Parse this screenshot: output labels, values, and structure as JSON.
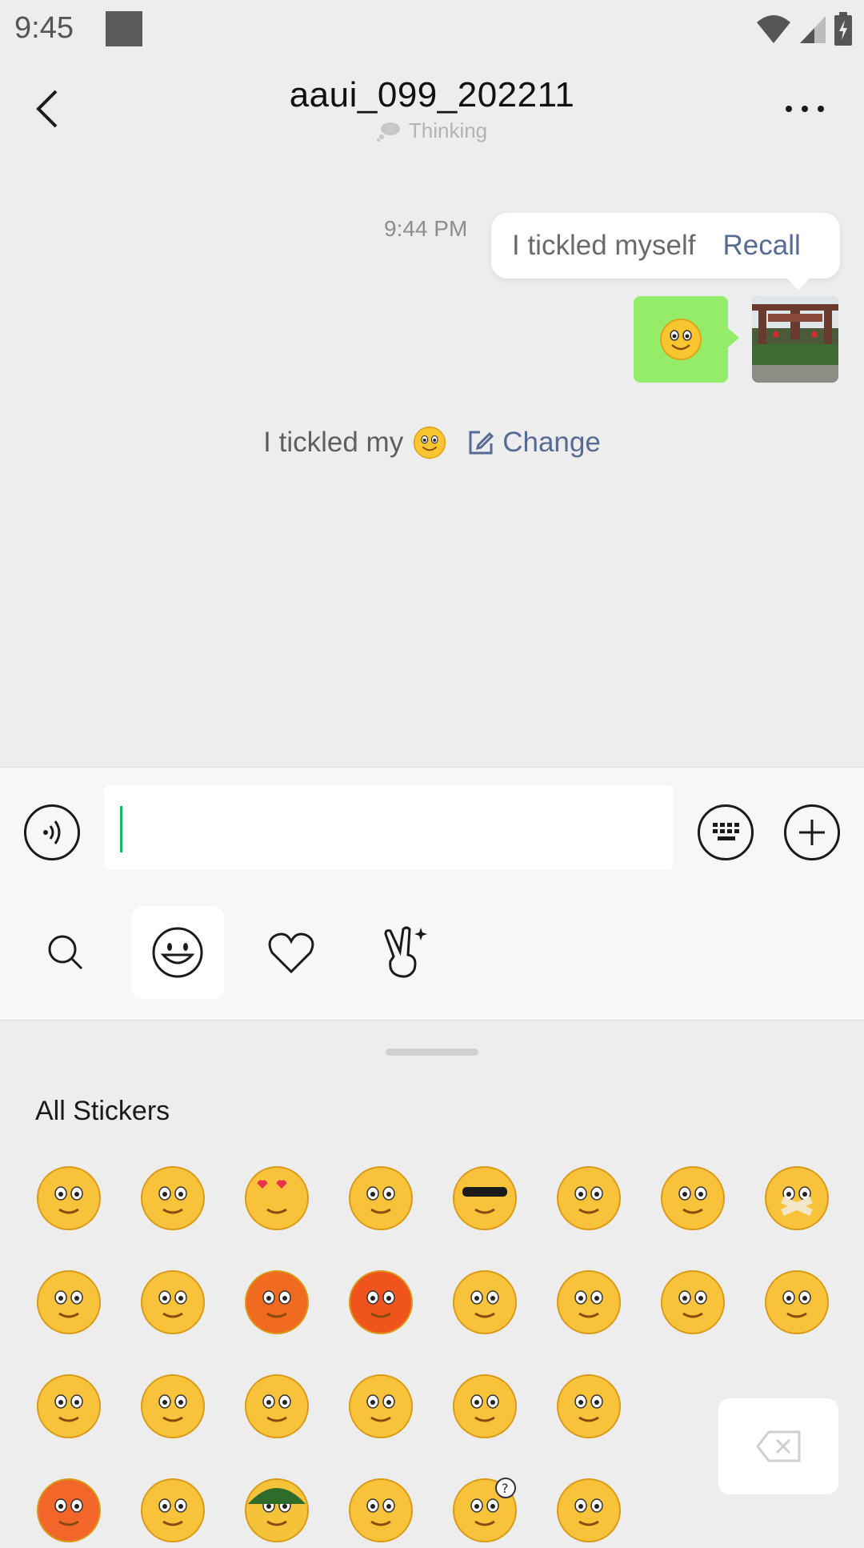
{
  "status_bar": {
    "time": "9:45"
  },
  "header": {
    "title": "aaui_099_202211",
    "status": "Thinking"
  },
  "chat": {
    "message_time": "9:44 PM",
    "tooltip": {
      "text": "I tickled myself",
      "action": "Recall"
    },
    "tickle_notice": {
      "text": "I  tickled my",
      "change_label": "Change"
    }
  },
  "input": {
    "value": ""
  },
  "sticker_panel": {
    "title": "All Stickers",
    "stickers": [
      "smile",
      "worried",
      "heart-eyes",
      "stare",
      "cool",
      "cry",
      "shy",
      "mouth-taped",
      "sleepy",
      "laugh-cry",
      "blush-angry",
      "angry",
      "tongue-wink",
      "grin",
      "scared",
      "sad",
      "embarrassed",
      "big-laugh",
      "sick",
      "facepalm",
      "happy",
      "surprised",
      "panic",
      "grinning",
      "soldier",
      "crying-laugh",
      "question",
      "shush"
    ]
  }
}
